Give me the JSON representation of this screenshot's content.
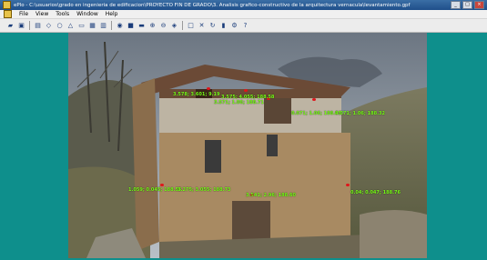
{
  "window": {
    "title": "ePlo - C:\\usuarios\\grado en ingenieria de edificacion\\PROYECTO FIN DE GRADO\\3. Analisis grafico-constructivo de la arquitectura vernacula\\levantamiento.gpf",
    "controls": [
      "_",
      "□",
      "×"
    ]
  },
  "menu": [
    "File",
    "View",
    "Tools",
    "Window",
    "Help"
  ],
  "toolbar_icons": [
    "open-icon",
    "save-icon",
    "print-icon",
    "point-icon",
    "polyline-icon",
    "triangle-icon",
    "rectangle-icon",
    "grid-icon",
    "table-icon",
    "database-icon",
    "camera-icon",
    "measure-icon",
    "zoom-in-icon",
    "zoom-out-icon",
    "fit-icon",
    "select-icon",
    "delete-icon",
    "refresh-icon",
    "stats-icon",
    "settings-icon",
    "help-icon"
  ],
  "points": [
    {
      "id": "p1",
      "label": "3.578; 3.601; 9.19"
    },
    {
      "id": "p2",
      "label": "3.575; 4.055; 188.58"
    },
    {
      "id": "p3",
      "label": "3.571; 1.06; 188.71"
    },
    {
      "id": "p4",
      "label": "0.071; 1.06; 188.95"
    },
    {
      "id": "p5",
      "label": "4.071; 1.06; 188.32"
    },
    {
      "id": "p6",
      "label": "1.059; 0.045; 188.56"
    },
    {
      "id": "p7",
      "label": "3.275; 3.055; 188.73"
    },
    {
      "id": "p8",
      "label": "3.541; 2.96; 188.60"
    },
    {
      "id": "p9",
      "label": "0.04; 0.047; 188.76"
    }
  ]
}
